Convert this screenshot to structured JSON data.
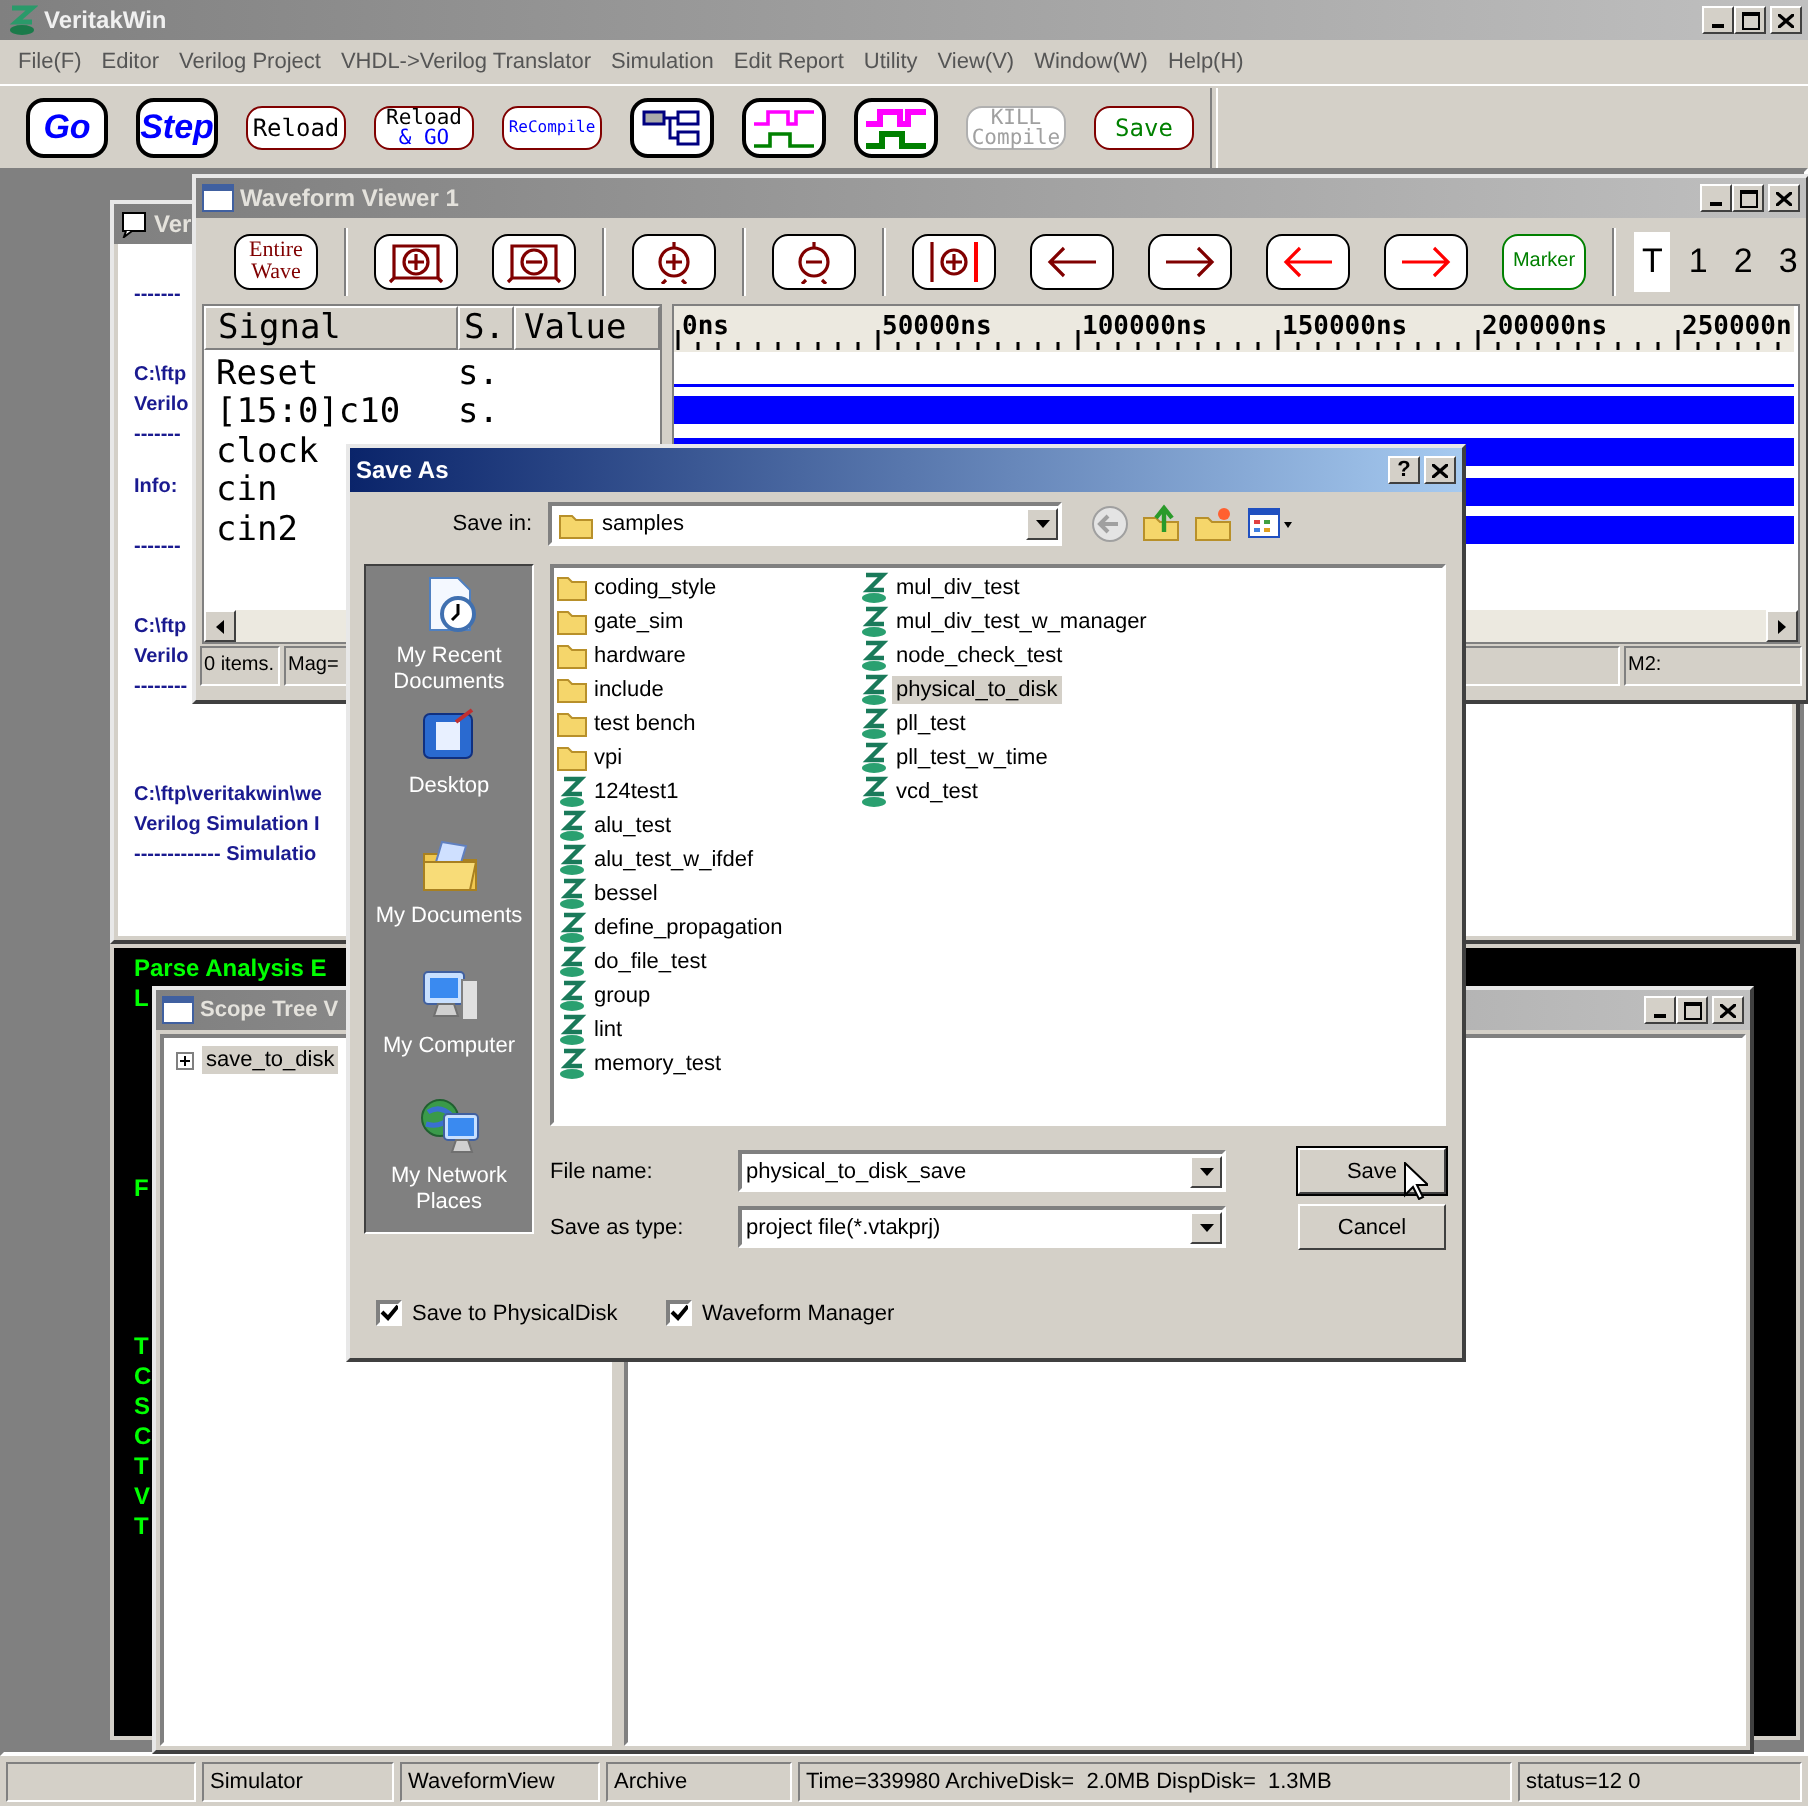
{
  "app": {
    "title": "VeritakWin",
    "active": false
  },
  "menu": [
    "File(F)",
    "Editor",
    "Verilog Project",
    "VHDL->Verilog Translator",
    "Simulation",
    "Edit Report",
    "Utility",
    "View(V)",
    "Window(W)",
    "Help(H)"
  ],
  "toolbar": [
    {
      "kind": "text",
      "lines": [
        {
          "text": "Go",
          "color": "#0000ff"
        }
      ],
      "emphasis": true,
      "disabled": false
    },
    {
      "kind": "text",
      "lines": [
        {
          "text": "Step",
          "color": "#0000ff"
        }
      ],
      "emphasis": true,
      "disabled": false
    },
    {
      "kind": "text",
      "lines": [
        {
          "text": "Reload",
          "color": "#000000"
        }
      ],
      "emphasis": false,
      "disabled": false
    },
    {
      "kind": "text",
      "lines": [
        {
          "text": "Reload",
          "color": "#000000"
        },
        {
          "text": "& GO",
          "color": "#0000ff"
        }
      ],
      "emphasis": false,
      "disabled": false
    },
    {
      "kind": "text",
      "lines": [
        {
          "text": "ReCompile",
          "color": "#0000ff"
        }
      ],
      "emphasis": false,
      "disabled": false
    },
    {
      "kind": "hierarchy"
    },
    {
      "kind": "waveform",
      "bold": false
    },
    {
      "kind": "waveform",
      "bold": true
    },
    {
      "kind": "text",
      "lines": [
        {
          "text": "KILL"
        },
        {
          "text": "Compile"
        }
      ],
      "emphasis": false,
      "disabled": true
    },
    {
      "kind": "text",
      "lines": [
        {
          "text": "Save",
          "color": "#008000"
        }
      ],
      "emphasis": false,
      "disabled": false
    }
  ],
  "log_window": {
    "title": "Ver",
    "active": false,
    "blocks": [
      [
        "-------"
      ],
      [
        "C:\\ftp",
        "Verilo",
        "-------"
      ],
      [
        "Info:"
      ],
      [
        "-------"
      ],
      [
        "C:\\ftp",
        "Verilo",
        "--------"
      ],
      [
        "C:\\ftp\\veritakwin\\we",
        "Verilog Simulation I",
        "------------- Simulatio"
      ]
    ]
  },
  "console": {
    "blocks": [
      [
        "Parse Analysis E",
        "L"
      ],
      [
        "F"
      ],
      [
        "T",
        "C",
        "S",
        "C",
        "T",
        "V",
        "T"
      ]
    ]
  },
  "scope_tree": {
    "title": "Scope Tree V",
    "active": false,
    "items": [
      {
        "label": "save_to_disk",
        "expanded": false,
        "selected": true
      }
    ]
  },
  "waveform_viewer": {
    "title": "Waveform Viewer 1",
    "active": false,
    "tools": [
      {
        "kind": "text",
        "lines": [
          "Entire",
          "Wave"
        ],
        "color": "#800000"
      },
      {
        "kind": "boxzoomin"
      },
      {
        "kind": "boxzoomout"
      },
      {
        "kind": "zoomin"
      },
      {
        "kind": "zoomout"
      },
      {
        "kind": "cursorzoom"
      },
      {
        "kind": "left",
        "color": "#800000"
      },
      {
        "kind": "right",
        "color": "#800000"
      },
      {
        "kind": "left",
        "color": "#ff0000"
      },
      {
        "kind": "right",
        "color": "#ff0000"
      },
      {
        "kind": "text",
        "lines": [
          "Marker"
        ],
        "color": "#008000"
      }
    ],
    "tabs": [
      {
        "label": "T",
        "selected": true
      },
      {
        "label": "1",
        "selected": false
      },
      {
        "label": "2",
        "selected": false
      },
      {
        "label": "3",
        "selected": false
      }
    ],
    "columns": [
      "Signal",
      "S.",
      "Value"
    ],
    "signals": [
      {
        "name": "Reset",
        "state": "s."
      },
      {
        "name": "[15:0]c10",
        "state": "s."
      },
      {
        "name": "clock"
      },
      {
        "name": "cin"
      },
      {
        "name": "cin2"
      }
    ],
    "timeline": [
      "0ns",
      "50000ns",
      "100000ns",
      "150000ns",
      "200000ns",
      "250000n"
    ],
    "status": [
      "0 items.",
      "Mag=",
      "M2:"
    ]
  },
  "save_dialog": {
    "title": "Save As",
    "active": true,
    "help": "?",
    "save_in_label": "Save in:",
    "save_in": "samples",
    "places": [
      {
        "kind": "recent",
        "label": "My Recent Documents"
      },
      {
        "kind": "desktop",
        "label": "Desktop"
      },
      {
        "kind": "documents",
        "label": "My Documents"
      },
      {
        "kind": "computer",
        "label": "My Computer"
      },
      {
        "kind": "network",
        "label": "My Network Places"
      }
    ],
    "files": [
      [
        {
          "name": "coding_style",
          "kind": "folder",
          "selected": false
        },
        {
          "name": "gate_sim",
          "kind": "folder",
          "selected": false
        },
        {
          "name": "hardware",
          "kind": "folder",
          "selected": false
        },
        {
          "name": "include",
          "kind": "folder",
          "selected": false
        },
        {
          "name": "test bench",
          "kind": "folder",
          "selected": false
        },
        {
          "name": "vpi",
          "kind": "folder",
          "selected": false
        },
        {
          "name": "124test1",
          "kind": "project",
          "selected": false
        },
        {
          "name": "alu_test",
          "kind": "project",
          "selected": false
        },
        {
          "name": "alu_test_w_ifdef",
          "kind": "project",
          "selected": false
        },
        {
          "name": "bessel",
          "kind": "project",
          "selected": false
        },
        {
          "name": "define_propagation",
          "kind": "project",
          "selected": false
        },
        {
          "name": "do_file_test",
          "kind": "project",
          "selected": false
        },
        {
          "name": "group",
          "kind": "project",
          "selected": false
        },
        {
          "name": "lint",
          "kind": "project",
          "selected": false
        },
        {
          "name": "memory_test",
          "kind": "project",
          "selected": false
        }
      ],
      [
        {
          "name": "mul_div_test",
          "kind": "project",
          "selected": false
        },
        {
          "name": "mul_div_test_w_manager",
          "kind": "project",
          "selected": false
        },
        {
          "name": "node_check_test",
          "kind": "project",
          "selected": false
        },
        {
          "name": "physical_to_disk",
          "kind": "project",
          "selected": true
        },
        {
          "name": "pll_test",
          "kind": "project",
          "selected": false
        },
        {
          "name": "pll_test_w_time",
          "kind": "project",
          "selected": false
        },
        {
          "name": "vcd_test",
          "kind": "project",
          "selected": false
        }
      ]
    ],
    "file_name_label": "File name:",
    "file_name": "physical_to_disk_save",
    "type_label": "Save as type:",
    "type": "project file(*.vtakprj)",
    "buttons": [
      {
        "label": "Save",
        "default": true
      },
      {
        "label": "Cancel",
        "default": false
      }
    ],
    "options": [
      {
        "label": "Save to PhysicalDisk",
        "checked": true
      },
      {
        "label": "Waveform Manager",
        "checked": true
      }
    ]
  },
  "status_bar": [
    "Simulator",
    "WaveformView",
    "Archive",
    "Time=339980 ArchiveDisk=  2.0MB DispDisk=  1.3MB",
    "status=12 0"
  ]
}
